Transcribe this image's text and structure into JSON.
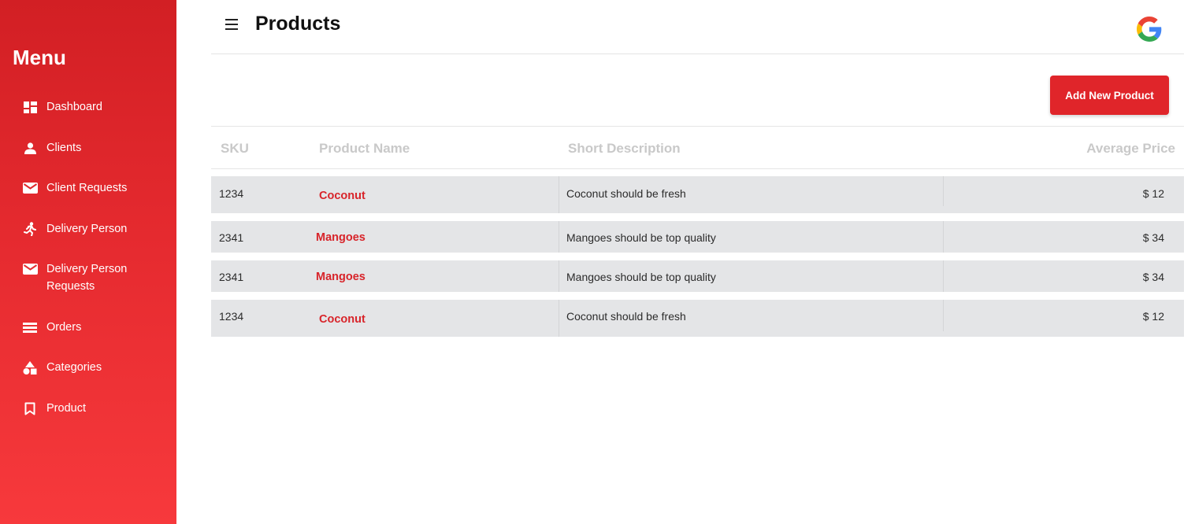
{
  "sidebar": {
    "title": "Menu",
    "items": [
      {
        "label": "Dashboard",
        "icon": "dashboard-icon"
      },
      {
        "label": "Clients",
        "icon": "person-icon"
      },
      {
        "label": "Client Requests",
        "icon": "mail-icon"
      },
      {
        "label": "Delivery Person",
        "icon": "running-person-icon"
      },
      {
        "label": "Delivery Person Requests",
        "icon": "mail-icon"
      },
      {
        "label": "Orders",
        "icon": "list-icon"
      },
      {
        "label": "Categories",
        "icon": "shapes-icon"
      },
      {
        "label": "Product",
        "icon": "bookmark-icon"
      }
    ]
  },
  "header": {
    "title": "Products",
    "account_icon": "google-icon"
  },
  "toolbar": {
    "add_label": "Add New Product"
  },
  "table": {
    "columns": [
      "SKU",
      "Product Name",
      "Short Description",
      "Average Price"
    ],
    "rows": [
      {
        "sku": "1234",
        "name": "Coconut",
        "description": "Coconut should be fresh",
        "price": "$ 12"
      },
      {
        "sku": "2341",
        "name": "Mangoes",
        "description": "Mangoes should be top quality",
        "price": "$ 34"
      },
      {
        "sku": "2341",
        "name": "Mangoes",
        "description": "Mangoes should be top quality",
        "price": "$ 34"
      },
      {
        "sku": "1234",
        "name": "Coconut",
        "description": "Coconut should be fresh",
        "price": "$ 12"
      }
    ]
  },
  "colors": {
    "accent": "#e0252a",
    "sidebar_top": "#d21f24",
    "sidebar_bottom": "#f7393c",
    "row_bg": "#e4e5e7",
    "header_text": "#c9c9c9"
  }
}
